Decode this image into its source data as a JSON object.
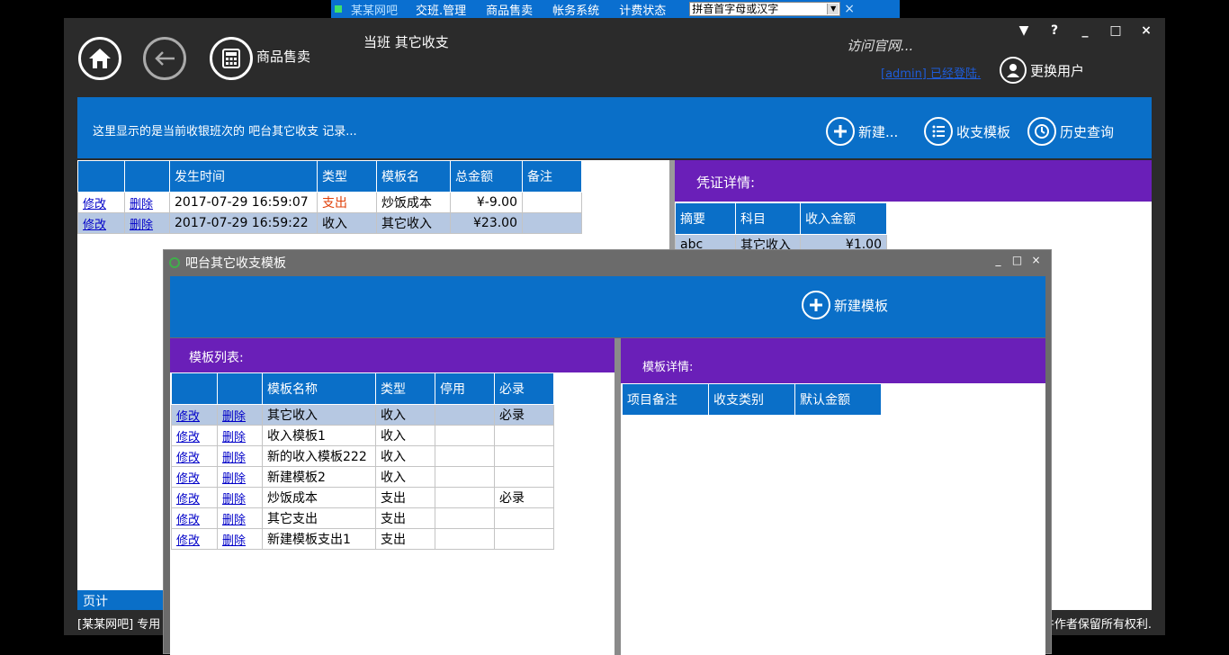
{
  "topnav": {
    "items": [
      "某某网吧",
      "交班.管理",
      "商品售卖",
      "帐务系统",
      "计费状态"
    ],
    "search_value": "拼音首字母或汉字",
    "close": "×"
  },
  "header": {
    "shop_label": "商品售卖",
    "current_shift": "当班  其它收支",
    "visit_site": "访问官网...",
    "user_status": "[admin] 已经登陆.",
    "switch_user": "更换用户",
    "window_controls": [
      "▼",
      "?",
      "_",
      "□",
      "×"
    ]
  },
  "toolbar": {
    "message": "这里显示的是当前收银班次的 吧台其它收支 记录...",
    "new_label": "新建...",
    "template_label": "收支模板",
    "history_label": "历史查询"
  },
  "records": {
    "columns": [
      "",
      "",
      "发生时间",
      "类型",
      "模板名",
      "总金额",
      "备注"
    ],
    "rows": [
      {
        "edit": "修改",
        "del": "删除",
        "time": "2017-07-29 16:59:07",
        "type": "支出",
        "template": "炒饭成本",
        "amount": "¥-9.00",
        "note": ""
      },
      {
        "edit": "修改",
        "del": "删除",
        "time": "2017-07-29 16:59:22",
        "type": "收入",
        "template": "其它收入",
        "amount": "¥23.00",
        "note": ""
      }
    ]
  },
  "voucher": {
    "title": "凭证详情:",
    "columns": [
      "摘要",
      "科目",
      "收入金额"
    ],
    "rows": [
      {
        "summary": "abc",
        "subject": "其它收入",
        "amount": "¥1.00"
      }
    ]
  },
  "pager": {
    "label": "页计"
  },
  "footer": {
    "left": "[某某网吧] 专用",
    "right": "件作者保留所有权利."
  },
  "dialog": {
    "title": "吧台其它收支模板",
    "controls": [
      "_",
      "□",
      "×"
    ],
    "new_template": "新建模板",
    "list_title": "模板列表:",
    "list_columns": [
      "",
      "",
      "模板名称",
      "类型",
      "停用",
      "必录"
    ],
    "list_rows": [
      {
        "edit": "修改",
        "del": "删除",
        "name": "其它收入",
        "type": "收入",
        "disabled": "",
        "required": "必录"
      },
      {
        "edit": "修改",
        "del": "删除",
        "name": "收入模板1",
        "type": "收入",
        "disabled": "",
        "required": ""
      },
      {
        "edit": "修改",
        "del": "删除",
        "name": "新的收入模板222",
        "type": "收入",
        "disabled": "",
        "required": ""
      },
      {
        "edit": "修改",
        "del": "删除",
        "name": "新建模板2",
        "type": "收入",
        "disabled": "",
        "required": ""
      },
      {
        "edit": "修改",
        "del": "删除",
        "name": "炒饭成本",
        "type": "支出",
        "disabled": "",
        "required": "必录"
      },
      {
        "edit": "修改",
        "del": "删除",
        "name": "其它支出",
        "type": "支出",
        "disabled": "",
        "required": ""
      },
      {
        "edit": "修改",
        "del": "删除",
        "name": "新建模板支出1",
        "type": "支出",
        "disabled": "",
        "required": ""
      }
    ],
    "detail_title": "模板详情:",
    "detail_columns": [
      "项目备注",
      "收支类别",
      "默认金额"
    ]
  }
}
